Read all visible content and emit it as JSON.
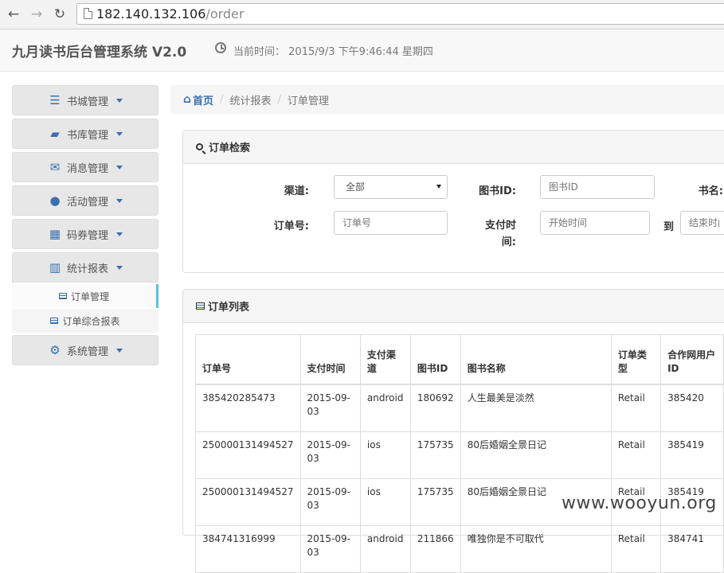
{
  "browser": {
    "url_host": "182.140.132.106",
    "url_path": "/order"
  },
  "header": {
    "title": "九月读书后台管理系统 V2.0",
    "time_label": "当前时间：",
    "time_value": "2015/9/3 下午9:46:44 星期四"
  },
  "sidebar": {
    "items": [
      {
        "label": "书城管理",
        "icon": "server-icon"
      },
      {
        "label": "书库管理",
        "icon": "book-icon"
      },
      {
        "label": "消息管理",
        "icon": "envelope-icon"
      },
      {
        "label": "活动管理",
        "icon": "users-icon"
      },
      {
        "label": "码券管理",
        "icon": "qrcode-icon"
      },
      {
        "label": "统计报表",
        "icon": "bar-chart-icon"
      },
      {
        "label": "系统管理",
        "icon": "gear-icon"
      }
    ],
    "submenu": [
      {
        "label": "订单管理",
        "active": true
      },
      {
        "label": "订单综合报表",
        "active": false
      }
    ]
  },
  "breadcrumb": {
    "home": "首页",
    "level1": "统计报表",
    "level2": "订单管理"
  },
  "search_panel": {
    "title": "订单检索",
    "channel_label": "渠道:",
    "channel_value": "全部",
    "book_id_label": "图书ID:",
    "book_id_placeholder": "图书ID",
    "book_name_label": "书名:",
    "order_no_label": "订单号:",
    "order_no_placeholder": "订单号",
    "pay_time_label_1": "支付时",
    "pay_time_label_2": "间:",
    "start_placeholder": "开始时间",
    "to_label": "到",
    "end_placeholder": "结束时间"
  },
  "list_panel": {
    "title": "订单列表",
    "columns": [
      "订单号",
      "支付时间",
      "支付渠道",
      "图书ID",
      "图书名称",
      "订单类型",
      "合作网用户ID"
    ],
    "rows": [
      [
        "385420285473",
        "2015-09-03",
        "android",
        "180692",
        "人生最美是淡然",
        "Retail",
        "385420"
      ],
      [
        "250000131494527",
        "2015-09-03",
        "ios",
        "175735",
        "80后婚姻全景日记",
        "Retail",
        "385419"
      ],
      [
        "250000131494527",
        "2015-09-03",
        "ios",
        "175735",
        "80后婚姻全景日记",
        "Retail",
        "385419"
      ],
      [
        "384741316999",
        "2015-09-03",
        "android",
        "211866",
        "唯独你是不可取代",
        "Retail",
        "384741"
      ]
    ]
  },
  "watermark": "www.wooyun.org",
  "colors": {
    "accent": "#3a6fb0",
    "active_border": "#5bc0de",
    "panel_heading": "#f5f5f5"
  }
}
